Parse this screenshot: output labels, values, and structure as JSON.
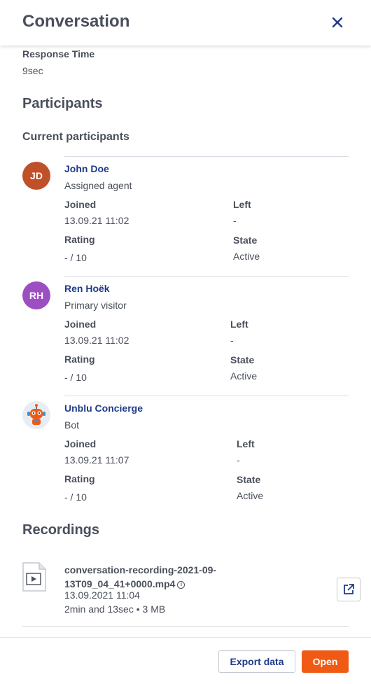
{
  "header": {
    "title": "Conversation",
    "close_icon": "close-icon"
  },
  "response_time": {
    "label": "Response Time",
    "value": "9sec"
  },
  "participants": {
    "heading": "Participants",
    "subheading": "Current participants",
    "labels": {
      "joined": "Joined",
      "left": "Left",
      "rating": "Rating",
      "state": "State"
    },
    "items": [
      {
        "initials": "JD",
        "avatar_color": "#c0502a",
        "name": "John Doe",
        "role": "Assigned agent",
        "joined": "13.09.21 11:02",
        "left": "-",
        "rating": "- / 10",
        "state": "Active"
      },
      {
        "initials": "RH",
        "avatar_color": "#9b4fc1",
        "name": "Ren Hoëk",
        "role": "Primary visitor",
        "joined": "13.09.21 11:02",
        "left": "-",
        "rating": "- / 10",
        "state": "Active"
      },
      {
        "initials": "",
        "avatar_icon": "robot-icon",
        "name": "Unblu Concierge",
        "role": "Bot",
        "joined": "13.09.21 11:07",
        "left": "-",
        "rating": "- / 10",
        "state": "Active"
      }
    ]
  },
  "recordings": {
    "heading": "Recordings",
    "items": [
      {
        "file_line1": "conversation-recording-2021-09-",
        "file_line2": "13T09_04_41+0000.mp4",
        "date": "13.09.2021 11:04",
        "details": "2min and 13sec • 3 MB"
      }
    ]
  },
  "footer": {
    "export_label": "Export data",
    "open_label": "Open"
  },
  "colors": {
    "accent": "#f05a14",
    "link": "#1f3a8a",
    "text": "#4a4f5c"
  }
}
